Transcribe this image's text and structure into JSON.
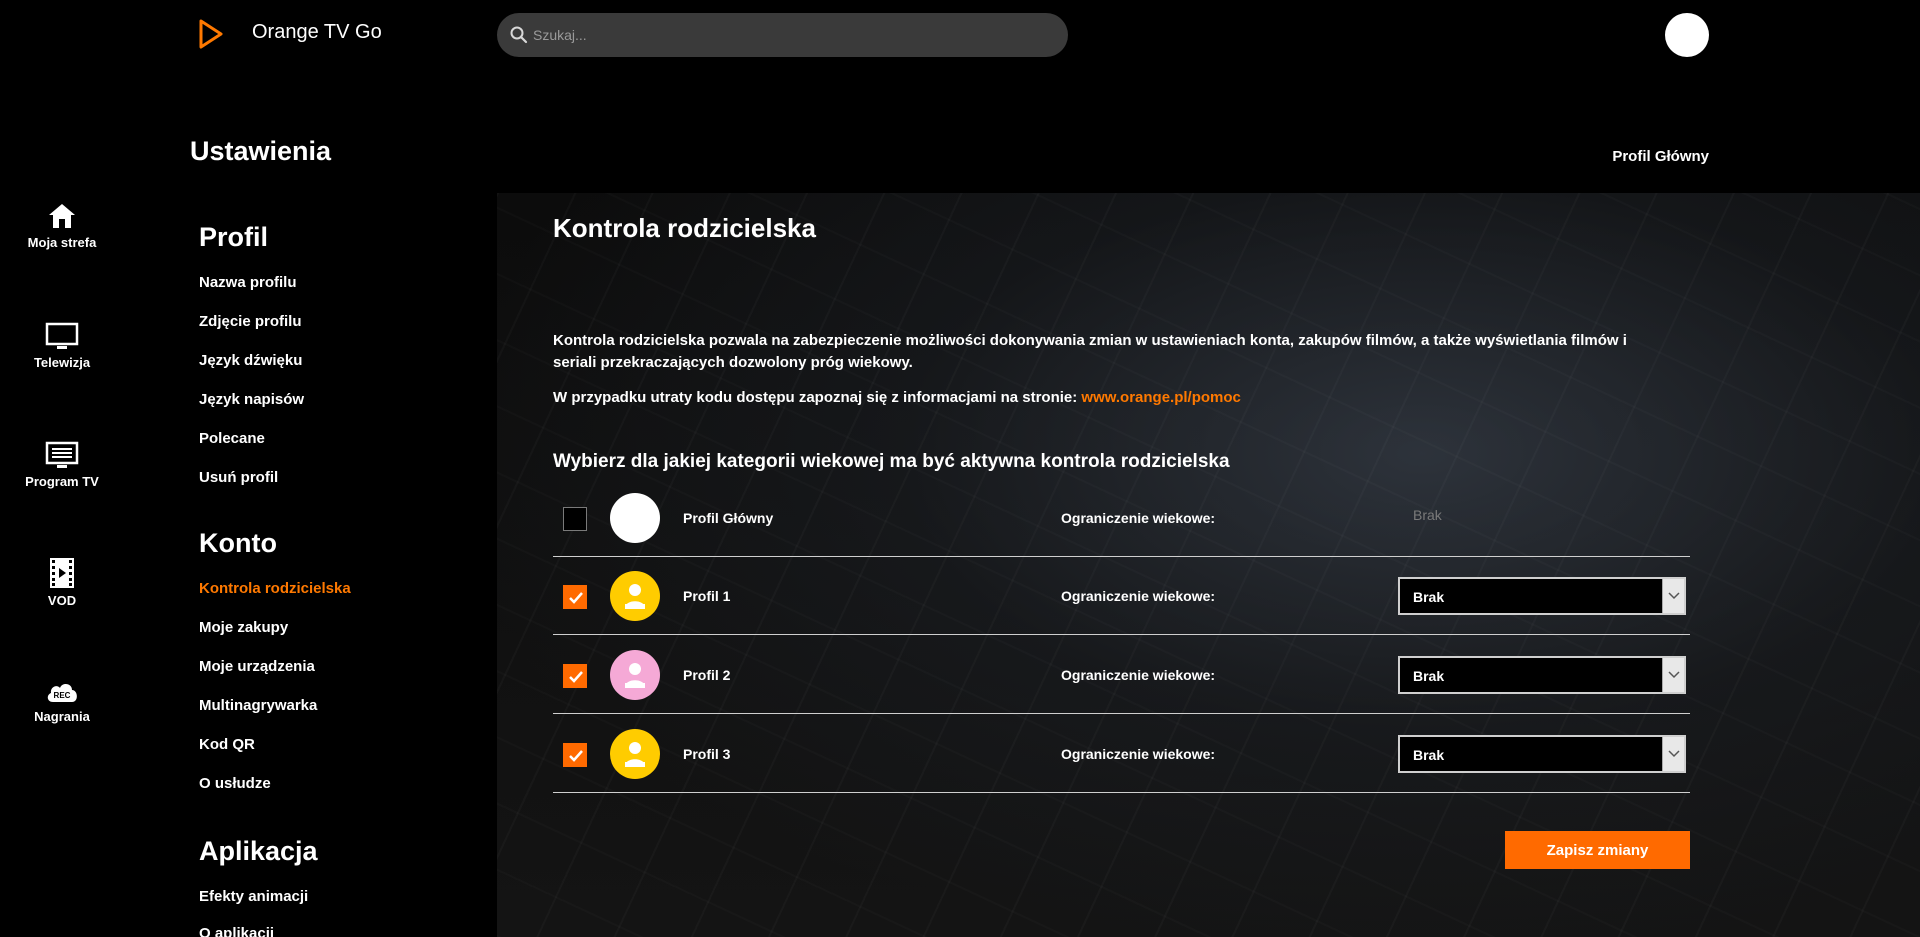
{
  "header": {
    "app_title": "Orange TV Go",
    "search_placeholder": "Szukaj...",
    "logo_icon": "play-triangle-logo-icon",
    "accent_color": "#ff7900"
  },
  "rail": {
    "items": [
      {
        "label": "Moja strefa",
        "icon": "home-icon"
      },
      {
        "label": "Telewizja",
        "icon": "tv-icon"
      },
      {
        "label": "Program TV",
        "icon": "tv-guide-icon"
      },
      {
        "label": "VOD",
        "icon": "film-icon"
      },
      {
        "label": "Nagrania",
        "icon": "rec-cloud-icon"
      }
    ]
  },
  "settings": {
    "title": "Ustawienia",
    "current_profile": "Profil Główny",
    "sections": [
      {
        "title": "Profil",
        "items": [
          "Nazwa profilu",
          "Zdjęcie profilu",
          "Język dźwięku",
          "Język napisów",
          "Polecane",
          "Usuń profil"
        ]
      },
      {
        "title": "Konto",
        "items": [
          "Kontrola rodzicielska",
          "Moje zakupy",
          "Moje urządzenia",
          "Multinagrywarka",
          "Kod QR",
          "O usłudze"
        ]
      },
      {
        "title": "Aplikacja",
        "items": [
          "Efekty animacji",
          "O aplikacji"
        ]
      }
    ],
    "active_item": "Kontrola rodzicielska"
  },
  "main": {
    "title": "Kontrola rodzicielska",
    "description": "Kontrola rodzicielska pozwala na zabezpieczenie możliwości dokonywania zmian w ustawieniach konta, zakupów filmów, a także wyświetlania filmów i seriali przekraczających dozwolony próg wiekowy.",
    "help_text": "W przypadku utraty kodu dostępu zapoznaj się z informacjami na stronie:",
    "help_link": "www.orange.pl/pomoc",
    "choose_label": "Wybierz dla jakiej kategorii wiekowej ma być aktywna kontrola rodzicielska",
    "limit_label": "Ograniczenie wiekowe:",
    "profiles": [
      {
        "name": "Profil Główny",
        "checked": false,
        "limit": "Brak",
        "avatar_color": "#ffffff"
      },
      {
        "name": "Profil 1",
        "checked": true,
        "limit": "Brak",
        "avatar_color": "#ffcc00"
      },
      {
        "name": "Profil 2",
        "checked": true,
        "limit": "Brak",
        "avatar_color": "#f5a9d6"
      },
      {
        "name": "Profil 3",
        "checked": true,
        "limit": "Brak",
        "avatar_color": "#ffcc00"
      }
    ],
    "save_label": "Zapisz zmiany"
  }
}
